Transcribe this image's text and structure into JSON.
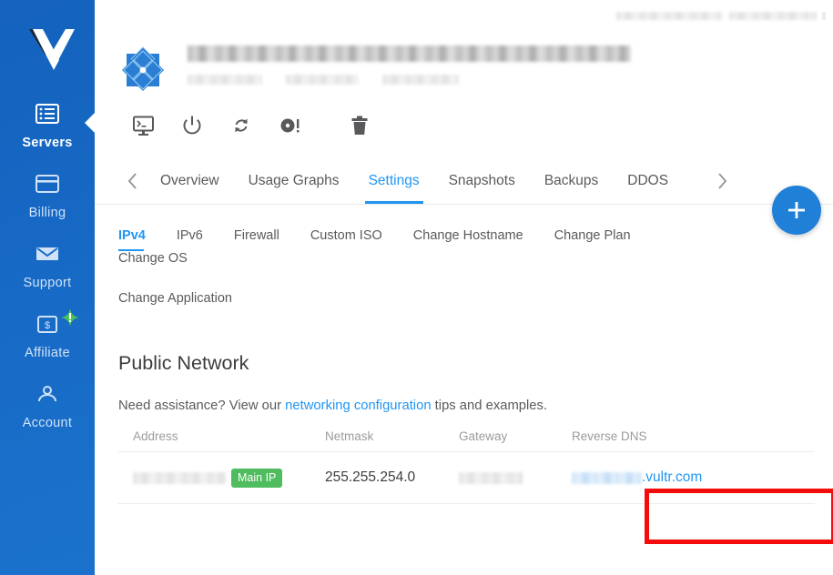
{
  "brand": {
    "logo_icon": "vultr-checkmark-logo"
  },
  "sidebar": {
    "items": [
      {
        "label": "Servers",
        "icon": "server-list-icon",
        "active": true
      },
      {
        "label": "Billing",
        "icon": "credit-card-icon",
        "active": false
      },
      {
        "label": "Support",
        "icon": "envelope-icon",
        "active": false
      },
      {
        "label": "Affiliate",
        "icon": "dollar-card-icon",
        "active": false,
        "badge_icon": "green-star-alert-icon"
      },
      {
        "label": "Account",
        "icon": "person-icon",
        "active": false
      }
    ]
  },
  "topbar": {
    "account_text_redacted": true
  },
  "server": {
    "os_logo_icon": "os-diamond-logo",
    "title_redacted": true,
    "sub_fields_redacted": 3,
    "actions": [
      {
        "label": "Console",
        "icon": "console-monitor-icon"
      },
      {
        "label": "Power",
        "icon": "power-icon"
      },
      {
        "label": "Restart",
        "icon": "restart-icon"
      },
      {
        "label": "Reinstall",
        "icon": "disc-alert-icon"
      },
      {
        "label": "Destroy",
        "icon": "trash-icon"
      }
    ]
  },
  "tabs": {
    "prev_icon": "chevron-left-icon",
    "next_icon": "chevron-right-icon",
    "items": [
      {
        "label": "Overview",
        "active": false
      },
      {
        "label": "Usage Graphs",
        "active": false
      },
      {
        "label": "Settings",
        "active": true
      },
      {
        "label": "Snapshots",
        "active": false
      },
      {
        "label": "Backups",
        "active": false
      },
      {
        "label": "DDOS",
        "active": false
      }
    ]
  },
  "fab": {
    "icon": "plus-icon",
    "label": "+"
  },
  "subtabs": {
    "row1": [
      {
        "label": "IPv4",
        "active": true
      },
      {
        "label": "IPv6",
        "active": false
      },
      {
        "label": "Firewall",
        "active": false
      },
      {
        "label": "Custom ISO",
        "active": false
      },
      {
        "label": "Change Hostname",
        "active": false
      },
      {
        "label": "Change Plan",
        "active": false
      },
      {
        "label": "Change OS",
        "active": false
      }
    ],
    "row2": [
      {
        "label": "Change Application",
        "active": false
      }
    ]
  },
  "section": {
    "title": "Public Network",
    "assist_prefix": "Need assistance? View our ",
    "assist_link": "networking configuration",
    "assist_suffix": " tips and examples."
  },
  "table": {
    "columns": [
      "Address",
      "Netmask",
      "Gateway",
      "Reverse DNS"
    ],
    "rows": [
      {
        "address_redacted": true,
        "address_badge": "Main IP",
        "netmask": "255.255.254.0",
        "gateway_redacted": true,
        "reverse_dns_prefix_redacted": true,
        "reverse_dns_suffix": ".vultr.com"
      }
    ]
  },
  "annotation": {
    "highlight_color": "#f40c0c",
    "highlight_target": "reverse-dns-cell"
  },
  "colors": {
    "sidebar_top": "#1462bd",
    "sidebar_bottom": "#1b72cc",
    "accent_blue": "#2196f3",
    "badge_green": "#4fbc5e",
    "fab_blue": "#2080d8"
  }
}
